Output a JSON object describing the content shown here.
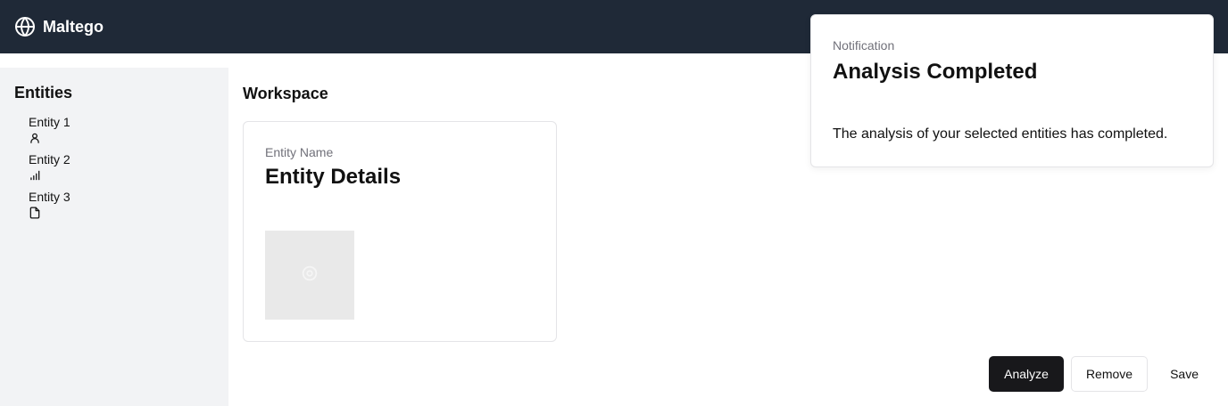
{
  "header": {
    "brand": "Maltego",
    "brand_icon": "globe-icon"
  },
  "sidebar": {
    "title": "Entities",
    "items": [
      {
        "label": "Entity 1",
        "icon": "user-icon"
      },
      {
        "label": "Entity 2",
        "icon": "signal-bars-icon"
      },
      {
        "label": "Entity 3",
        "icon": "file-icon"
      }
    ]
  },
  "workspace": {
    "title": "Workspace",
    "card": {
      "subtitle": "Entity Name",
      "title": "Entity Details",
      "image_icon": "image-loading-icon"
    }
  },
  "notification": {
    "subtitle": "Notification",
    "title": "Analysis Completed",
    "body": "The analysis of your selected entities has completed."
  },
  "actions": {
    "analyze": "Analyze",
    "remove": "Remove",
    "save": "Save"
  },
  "colors": {
    "topbar": "#1f2937",
    "sidebar": "#f2f3f5",
    "primary": "#18181b"
  }
}
